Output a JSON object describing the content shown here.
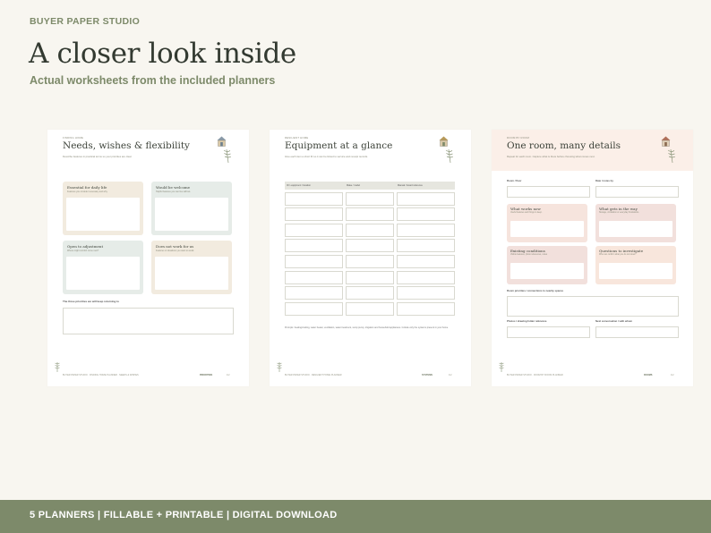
{
  "brand": "BUYER PAPER STUDIO",
  "headline": "A closer look inside",
  "subline": "Actual worksheets from the included planners",
  "colors": {
    "accent": "#7d8a6a",
    "background": "#f8f6f0",
    "heading": "#333a31"
  },
  "sheets": [
    {
      "kicker": "FINDING HOME",
      "title": "Needs, wishes & flexibility",
      "desc": "Describe features in practical terms so your priorities are clear.",
      "cards": [
        {
          "title": "Essential for daily life",
          "sub": "Features you consider necessary and why."
        },
        {
          "title": "Would be welcome",
          "sub": "Helpful features you can live without."
        },
        {
          "title": "Open to adjustment",
          "sub": "Where might comfort come next?"
        },
        {
          "title": "Does not work for us",
          "sub": "Features or situations you want to avoid."
        }
      ],
      "priorities_label": "The three priorities we will keep returning to",
      "footer_left": "BUYER PAPER STUDIO · FINDING HOME PLANNER · NEEDS & WISHES",
      "footer_right": "PRIORITIES",
      "page": "1/2"
    },
    {
      "kicker": "RESILIENT HOME",
      "title": "Equipment at a glance",
      "desc": "Give each item a short ID so it can be linked to service and receipt records.",
      "columns": [
        "ID / equipment / location",
        "Make / model",
        "Manual / board reference"
      ],
      "note": "Prompts: heating/cooling, water heater, ventilation, water treatment, sump pump, irrigation and household appliances. Include only the systems present in your home.",
      "footer_left": "BUYER PAPER STUDIO · RESILIENT HOME PLANNER",
      "footer_right": "SYSTEMS",
      "page": "1/2"
    },
    {
      "kicker": "ROOM BY ROOM",
      "title": "One room, many details",
      "desc": "Repeat for each room. Capture what is there before choosing what comes next.",
      "room_label": "Room / floor",
      "date_label": "Date / notes by",
      "cards": [
        {
          "title": "What works now",
          "sub": "Useful features and things to keep."
        },
        {
          "title": "What gets in the way",
          "sub": "Storage, circulation or everyday frustrations."
        },
        {
          "title": "Existing conditions",
          "sub": "Visible features, photo references, notes"
        },
        {
          "title": "Questions to investigate",
          "sub": "Who can confirm what you do not know?"
        }
      ],
      "priorities_label": "Room priorities / connections to nearby spaces",
      "photos_label": "Photos / drawing folder reference",
      "next_label": "Next conversation / with whom",
      "footer_left": "BUYER PAPER STUDIO · ROOM BY ROOM PLANNER",
      "footer_right": "ROOMS",
      "page": "1/2"
    }
  ],
  "footer": "5 PLANNERS  |  FILLABLE + PRINTABLE  |  DIGITAL DOWNLOAD"
}
